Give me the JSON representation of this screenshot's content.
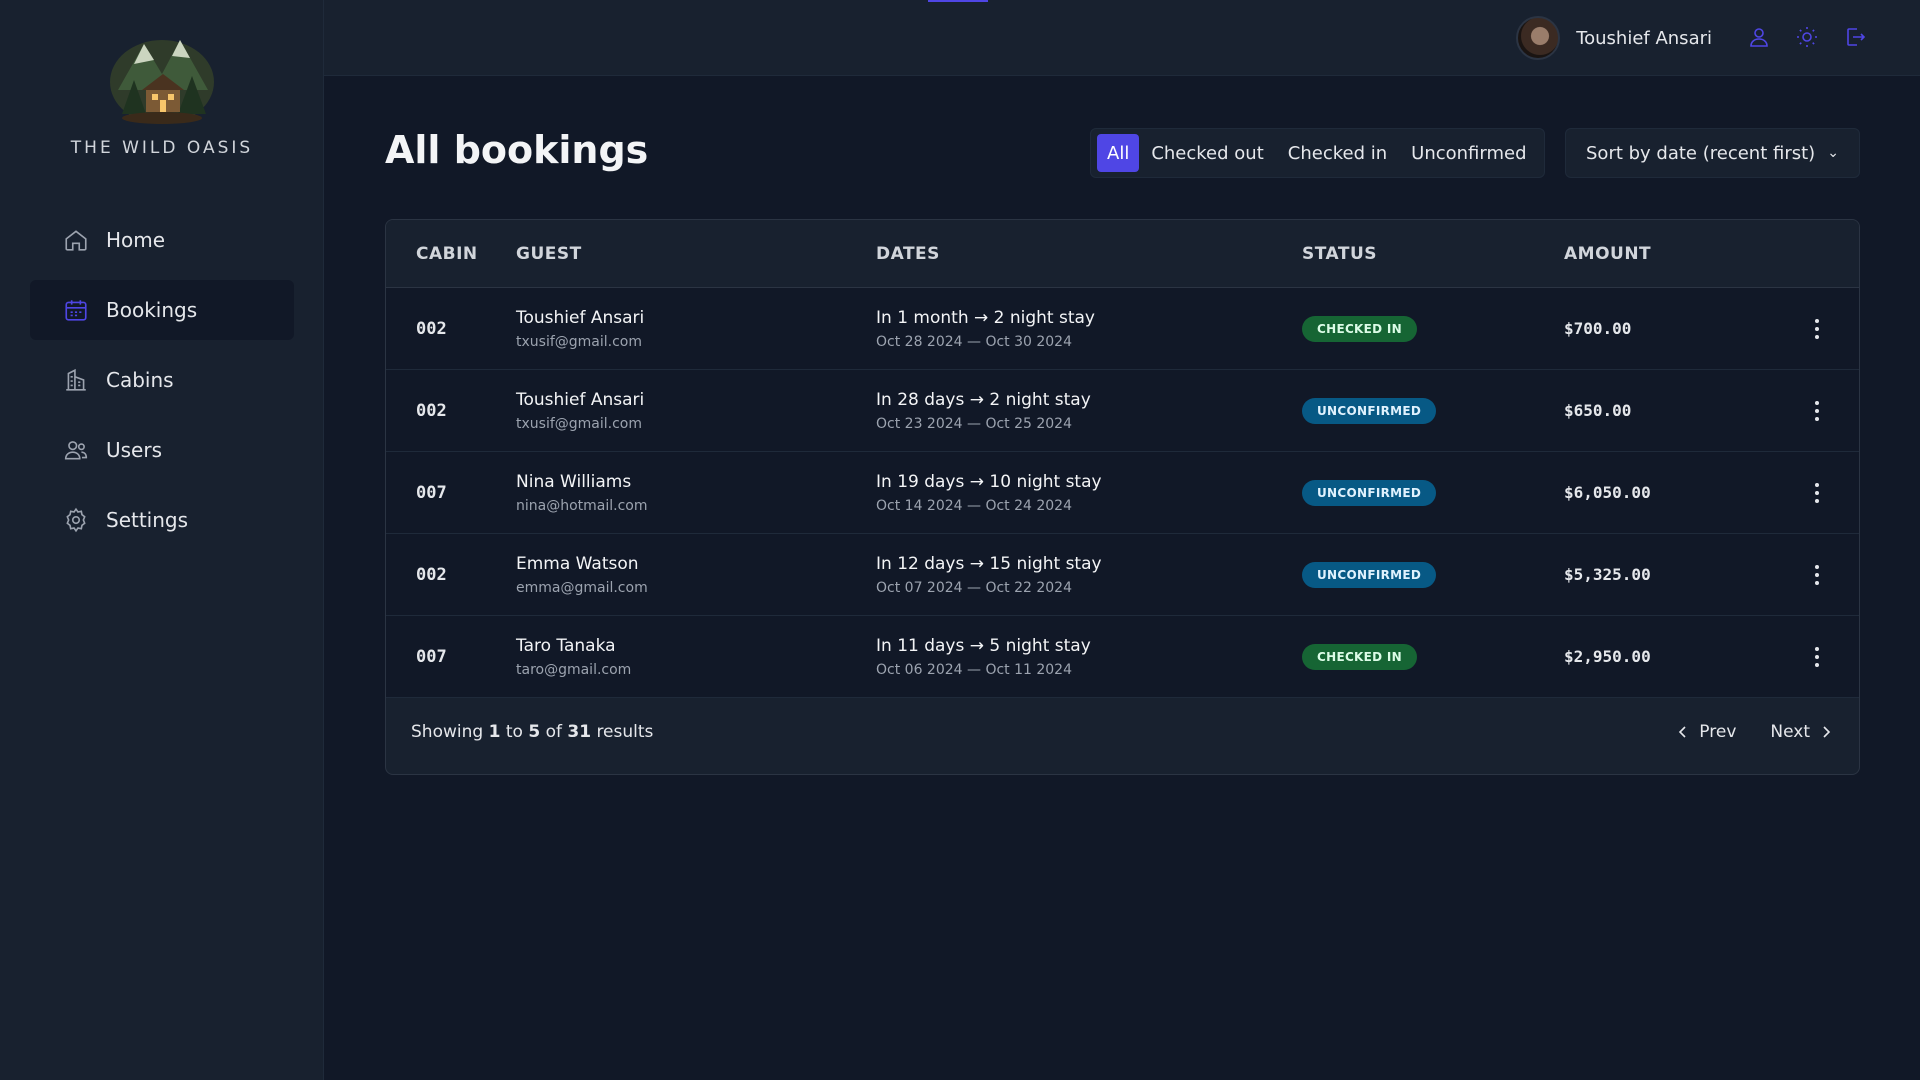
{
  "brand": {
    "name": "THE WILD OASIS"
  },
  "sidebar": {
    "items": [
      {
        "label": "Home",
        "icon": "home-icon"
      },
      {
        "label": "Bookings",
        "icon": "calendar-icon",
        "active": true
      },
      {
        "label": "Cabins",
        "icon": "building-icon"
      },
      {
        "label": "Users",
        "icon": "users-icon"
      },
      {
        "label": "Settings",
        "icon": "gear-icon"
      }
    ]
  },
  "header": {
    "user_name": "Toushief Ansari",
    "icons": [
      "user-icon",
      "sun-icon",
      "logout-icon"
    ],
    "accent_color": "#4f46e5"
  },
  "main": {
    "title": "All bookings",
    "filters": [
      "All",
      "Checked out",
      "Checked in",
      "Unconfirmed"
    ],
    "active_filter": "All",
    "sort": {
      "selected": "Sort by date (recent first)"
    }
  },
  "table": {
    "headers": [
      "CABIN",
      "GUEST",
      "DATES",
      "STATUS",
      "AMOUNT"
    ],
    "rows": [
      {
        "cabin": "002",
        "guest": "Toushief Ansari",
        "email": "txusif@gmail.com",
        "stay": "In 1 month → 2 night stay",
        "dates": "Oct 28 2024 — Oct 30 2024",
        "status": "CHECKED IN",
        "amount": "$700.00"
      },
      {
        "cabin": "002",
        "guest": "Toushief Ansari",
        "email": "txusif@gmail.com",
        "stay": "In 28 days → 2 night stay",
        "dates": "Oct 23 2024 — Oct 25 2024",
        "status": "UNCONFIRMED",
        "amount": "$650.00"
      },
      {
        "cabin": "007",
        "guest": "Nina Williams",
        "email": "nina@hotmail.com",
        "stay": "In 19 days → 10 night stay",
        "dates": "Oct 14 2024 — Oct 24 2024",
        "status": "UNCONFIRMED",
        "amount": "$6,050.00"
      },
      {
        "cabin": "002",
        "guest": "Emma Watson",
        "email": "emma@gmail.com",
        "stay": "In 12 days → 15 night stay",
        "dates": "Oct 07 2024 — Oct 22 2024",
        "status": "UNCONFIRMED",
        "amount": "$5,325.00"
      },
      {
        "cabin": "007",
        "guest": "Taro Tanaka",
        "email": "taro@gmail.com",
        "stay": "In 11 days → 5 night stay",
        "dates": "Oct 06 2024 — Oct 11 2024",
        "status": "CHECKED IN",
        "amount": "$2,950.00"
      }
    ],
    "footer": {
      "showing_prefix": "Showing",
      "from": "1",
      "to_word": "to",
      "to": "5",
      "of_word": "of",
      "total": "31",
      "results_word": "results",
      "prev": "Prev",
      "next": "Next"
    }
  },
  "colors": {
    "status_checked_in": "#166534",
    "status_unconfirmed": "#075985"
  }
}
